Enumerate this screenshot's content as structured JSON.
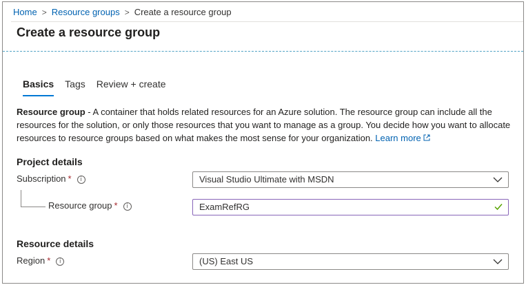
{
  "breadcrumb": {
    "home": "Home",
    "resource_groups": "Resource groups",
    "current": "Create a resource group",
    "separator": ">"
  },
  "page_title": "Create a resource group",
  "tabs": [
    {
      "label": "Basics",
      "active": true
    },
    {
      "label": "Tags",
      "active": false
    },
    {
      "label": "Review + create",
      "active": false
    }
  ],
  "description": {
    "term": "Resource group",
    "text": " - A container that holds related resources for an Azure solution. The resource group can include all the resources for the solution, or only those resources that you want to manage as a group. You decide how you want to allocate resources to resource groups based on what makes the most sense for your organization. ",
    "learn_more": "Learn more"
  },
  "project_details": {
    "heading": "Project details",
    "subscription": {
      "label": "Subscription",
      "required": "*",
      "value": "Visual Studio Ultimate with MSDN"
    },
    "resource_group": {
      "label": "Resource group",
      "required": "*",
      "value": "ExamRefRG"
    }
  },
  "resource_details": {
    "heading": "Resource details",
    "region": {
      "label": "Region",
      "required": "*",
      "value": "(US) East US"
    }
  },
  "icons": {
    "info": "info-icon",
    "chevron": "chevron-down-icon",
    "check": "checkmark-icon",
    "external": "external-link-icon"
  },
  "colors": {
    "link": "#0062b1",
    "accent": "#0078d4",
    "required": "#a4262c",
    "valid_check": "#57a300",
    "valid_border": "#8764b8"
  }
}
